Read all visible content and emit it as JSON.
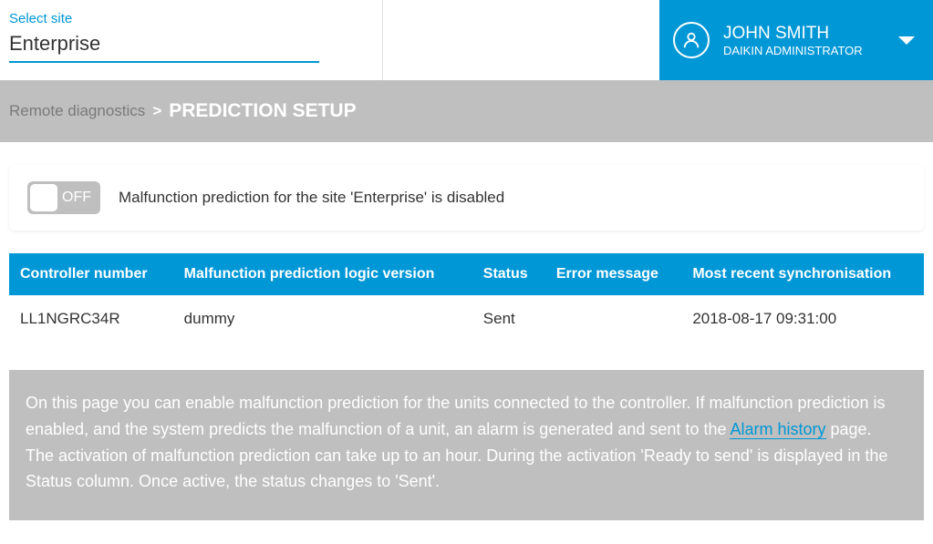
{
  "header": {
    "site_label": "Select site",
    "site_value": "Enterprise",
    "user_name": "JOHN SMITH",
    "user_role": "DAIKIN ADMINISTRATOR"
  },
  "breadcrumb": {
    "parent": "Remote diagnostics",
    "separator": ">",
    "current": "PREDICTION SETUP"
  },
  "toggle_card": {
    "state_label": "OFF",
    "description": "Malfunction prediction for the site 'Enterprise' is disabled"
  },
  "table": {
    "headers": {
      "controller_number": "Controller number",
      "logic_version": "Malfunction prediction logic version",
      "status": "Status",
      "error_message": "Error message",
      "recent_sync": "Most recent synchronisation"
    },
    "rows": [
      {
        "controller_number": "LL1NGRC34R",
        "logic_version": "dummy",
        "status": "Sent",
        "error_message": "",
        "recent_sync": "2018-08-17 09:31:00"
      }
    ]
  },
  "info": {
    "p1_before_link": "On this page you can enable malfunction prediction for the units connected to the controller. If malfunction prediction is enabled, and the system predicts the malfunction of a unit, an alarm is generated and sent to the ",
    "link_text": "Alarm history",
    "p1_after_link": " page.",
    "p2": "The activation of malfunction prediction can take up to an hour. During the activation 'Ready to send' is displayed in the Status column. Once active, the status changes to 'Sent'."
  }
}
